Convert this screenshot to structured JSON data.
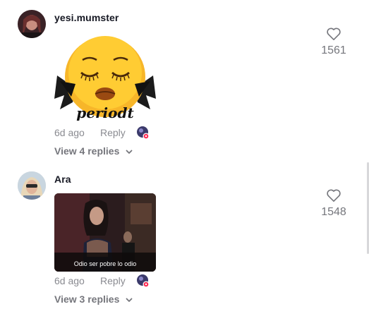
{
  "comments": [
    {
      "username": "yesi.mumster",
      "time": "6d ago",
      "reply_label": "Reply",
      "view_replies": "View 4 replies",
      "likes": "1561",
      "media": {
        "type": "sticker",
        "text": "periodt"
      }
    },
    {
      "username": "Ara",
      "time": "6d ago",
      "reply_label": "Reply",
      "view_replies": "View 3 replies",
      "likes": "1548",
      "media": {
        "type": "gif",
        "caption": "Odio ser pobre lo odio"
      }
    }
  ],
  "icons": {
    "like": "heart-outline-icon",
    "expand": "chevron-down-icon",
    "creator_badge": "creator-liked-badge-icon"
  },
  "colors": {
    "text": "#161823",
    "muted": "#8a8b91",
    "badge_dot": "#fe2c55"
  }
}
